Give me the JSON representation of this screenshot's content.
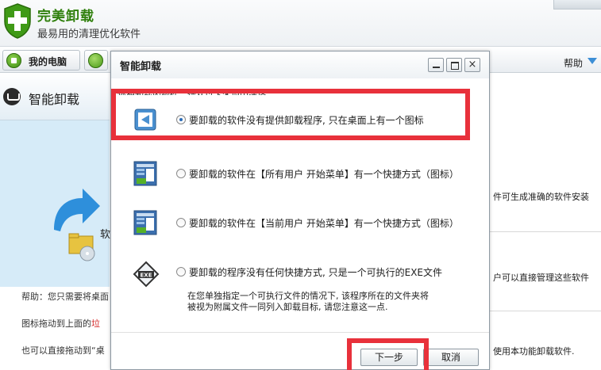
{
  "app": {
    "title": "完美卸载",
    "subtitle": "最易用的清理优化软件",
    "toolbar": {
      "my_pc_label": "我的电脑",
      "help_label": "帮助"
    },
    "sidebar": {
      "title": "智能卸载",
      "cut_label": "软"
    },
    "right_panel": {
      "line1": "件可生成准确的软件安装",
      "line2": "户可以直接管理这些软件",
      "line3": "使用本功能卸载软件."
    },
    "help_panel": {
      "line1": "帮助：您只需要将桌面",
      "line2_prefix": "图标拖动到上面的",
      "line2_red": "垃",
      "line3": "也可以直接拖动到“桌"
    }
  },
  "dialog": {
    "title": "智能卸载",
    "controls": {
      "close": "×"
    },
    "instruction": "您想卸载的软件，请从以下各项中选择",
    "options": [
      {
        "label": "要卸载的软件没有提供卸载程序, 只在桌面上有一个图标",
        "checked": true,
        "icon": "uninstall-shortcut-icon"
      },
      {
        "label": "要卸载的软件在【所有用户 开始菜单】有一个快捷方式（图标）",
        "checked": false,
        "icon": "start-menu-icon"
      },
      {
        "label": "要卸载的软件在【当前用户 开始菜单】有一个快捷方式（图标）",
        "checked": false,
        "icon": "start-menu-icon"
      },
      {
        "label": "要卸载的程序没有任何快捷方式, 只是一个可执行的EXE文件",
        "checked": false,
        "icon": "exe-file-icon"
      }
    ],
    "note_line1": "在您单独指定一个可执行文件的情况下, 该程序所在的文件夹将",
    "note_line2": "被视为附属文件一同列入卸载目标, 请您注意这一点.",
    "buttons": {
      "next": "下一步",
      "cancel": "取消"
    }
  },
  "colors": {
    "highlight": "#e8313b",
    "brand_green": "#2f7f0c",
    "sidebar_blue": "#d6ebf8"
  }
}
